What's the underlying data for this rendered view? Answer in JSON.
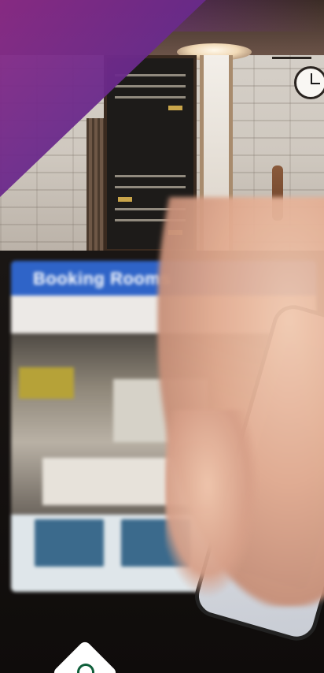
{
  "screen": {
    "title": "Booking Rooms"
  }
}
